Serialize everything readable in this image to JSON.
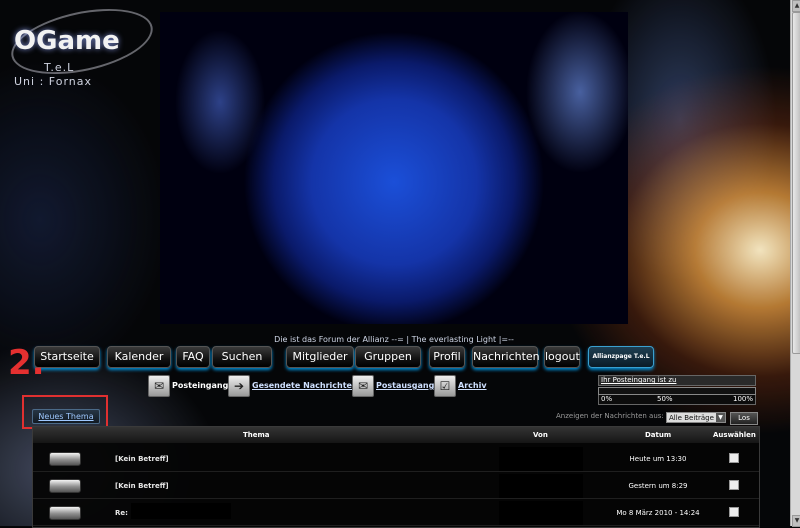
{
  "logo": {
    "text": "OGame",
    "sub1": "T.e.L",
    "sub2": "Uni : Fornax"
  },
  "tagline": "Die ist das Forum der Allianz --= | The everlasting Light |=--",
  "nav": [
    {
      "label": "Startseite"
    },
    {
      "label": "Kalender"
    },
    {
      "label": "FAQ"
    },
    {
      "label": "Suchen"
    },
    {
      "label": "Mitglieder"
    },
    {
      "label": "Gruppen"
    },
    {
      "label": "Profil"
    },
    {
      "label": "Nachrichten"
    },
    {
      "label": "logout"
    },
    {
      "label": "Allianzpage T.e.L"
    }
  ],
  "annotation": {
    "number": "2."
  },
  "new_thread_label": "Neues Thema",
  "mailbox": [
    {
      "label": "Posteingang",
      "icon": "inbox-icon"
    },
    {
      "label": "Gesendete Nachrichten",
      "icon": "arrow-right-icon"
    },
    {
      "label": "Postausgang",
      "icon": "outbox-icon"
    },
    {
      "label": "Archiv",
      "icon": "archive-icon"
    }
  ],
  "quota": {
    "title": "Ihr Posteingang ist zu",
    "percent": 0,
    "min": "0%",
    "mid": "50%",
    "max": "100%"
  },
  "filter": {
    "label": "Anzeigen der Nachrichten aus:",
    "selected": "Alle Beiträge",
    "button": "Los"
  },
  "table": {
    "headers": {
      "subject": "Thema",
      "from": "Von",
      "date": "Datum",
      "select": "Auswählen"
    },
    "rows": [
      {
        "subject": "[Kein Betreff]",
        "date": "Heute um 13:30"
      },
      {
        "subject": "[Kein Betreff]",
        "date": "Gestern um 8:29"
      },
      {
        "subject": "Re:",
        "date": "Mo 8 März 2010 - 14:24"
      }
    ]
  },
  "colors": {
    "accent_glow": "#00aaff",
    "annotation": "#e53030",
    "link": "#9ec8ff"
  }
}
